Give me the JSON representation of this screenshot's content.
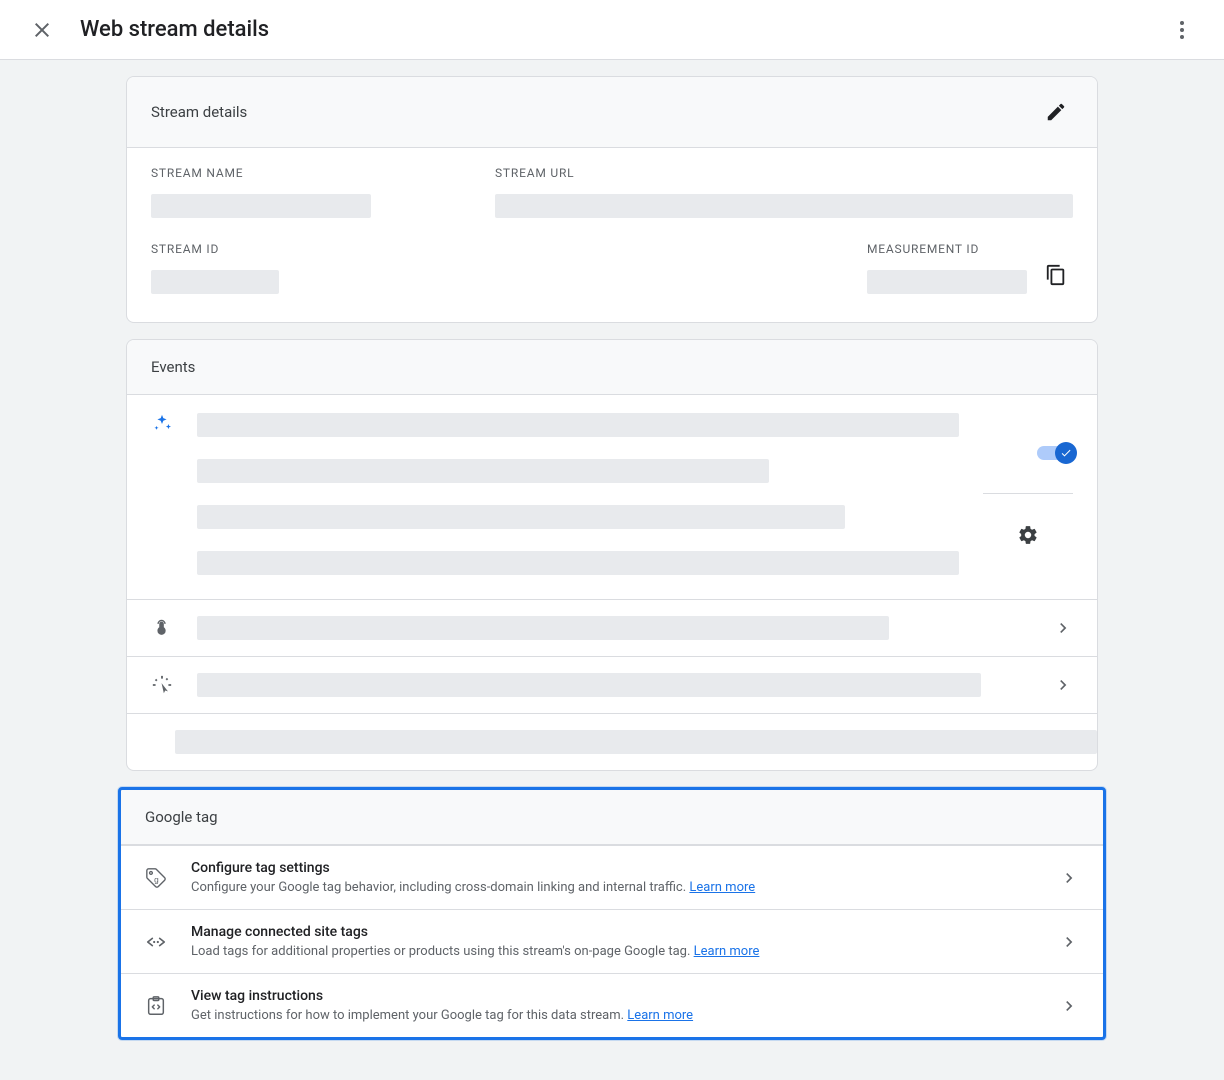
{
  "page": {
    "title": "Web stream details"
  },
  "streamDetails": {
    "heading": "Stream details",
    "fields": {
      "streamName": "STREAM NAME",
      "streamUrl": "STREAM URL",
      "streamId": "STREAM ID",
      "measurementId": "MEASUREMENT ID"
    }
  },
  "events": {
    "heading": "Events"
  },
  "googleTag": {
    "heading": "Google tag",
    "rows": {
      "configure": {
        "title": "Configure tag settings",
        "desc": "Configure your Google tag behavior, including cross-domain linking and internal traffic.",
        "learn": "Learn more"
      },
      "connected": {
        "title": "Manage connected site tags",
        "desc": "Load tags for additional properties or products using this stream's on-page Google tag.",
        "learn": "Learn more"
      },
      "instructions": {
        "title": "View tag instructions",
        "desc": "Get instructions for how to implement your Google tag for this data stream.",
        "learn": "Learn more"
      }
    }
  }
}
